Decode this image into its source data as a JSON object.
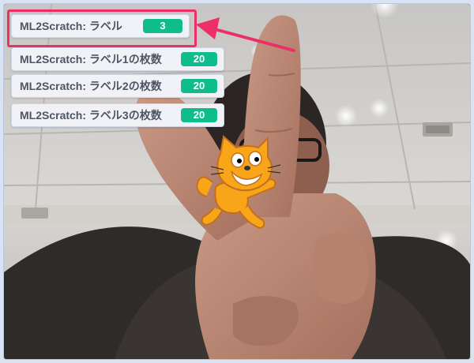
{
  "stage": {
    "sprite_name": "scratch-cat",
    "accent_color": "#0fbd8c",
    "highlight_color": "#ec2f67"
  },
  "monitors": [
    {
      "label": "ML2Scratch: ラベル",
      "value": "3"
    },
    {
      "label": "ML2Scratch: ラベル1の枚数",
      "value": "20"
    },
    {
      "label": "ML2Scratch: ラベル2の枚数",
      "value": "20"
    },
    {
      "label": "ML2Scratch: ラベル3の枚数",
      "value": "20"
    }
  ]
}
